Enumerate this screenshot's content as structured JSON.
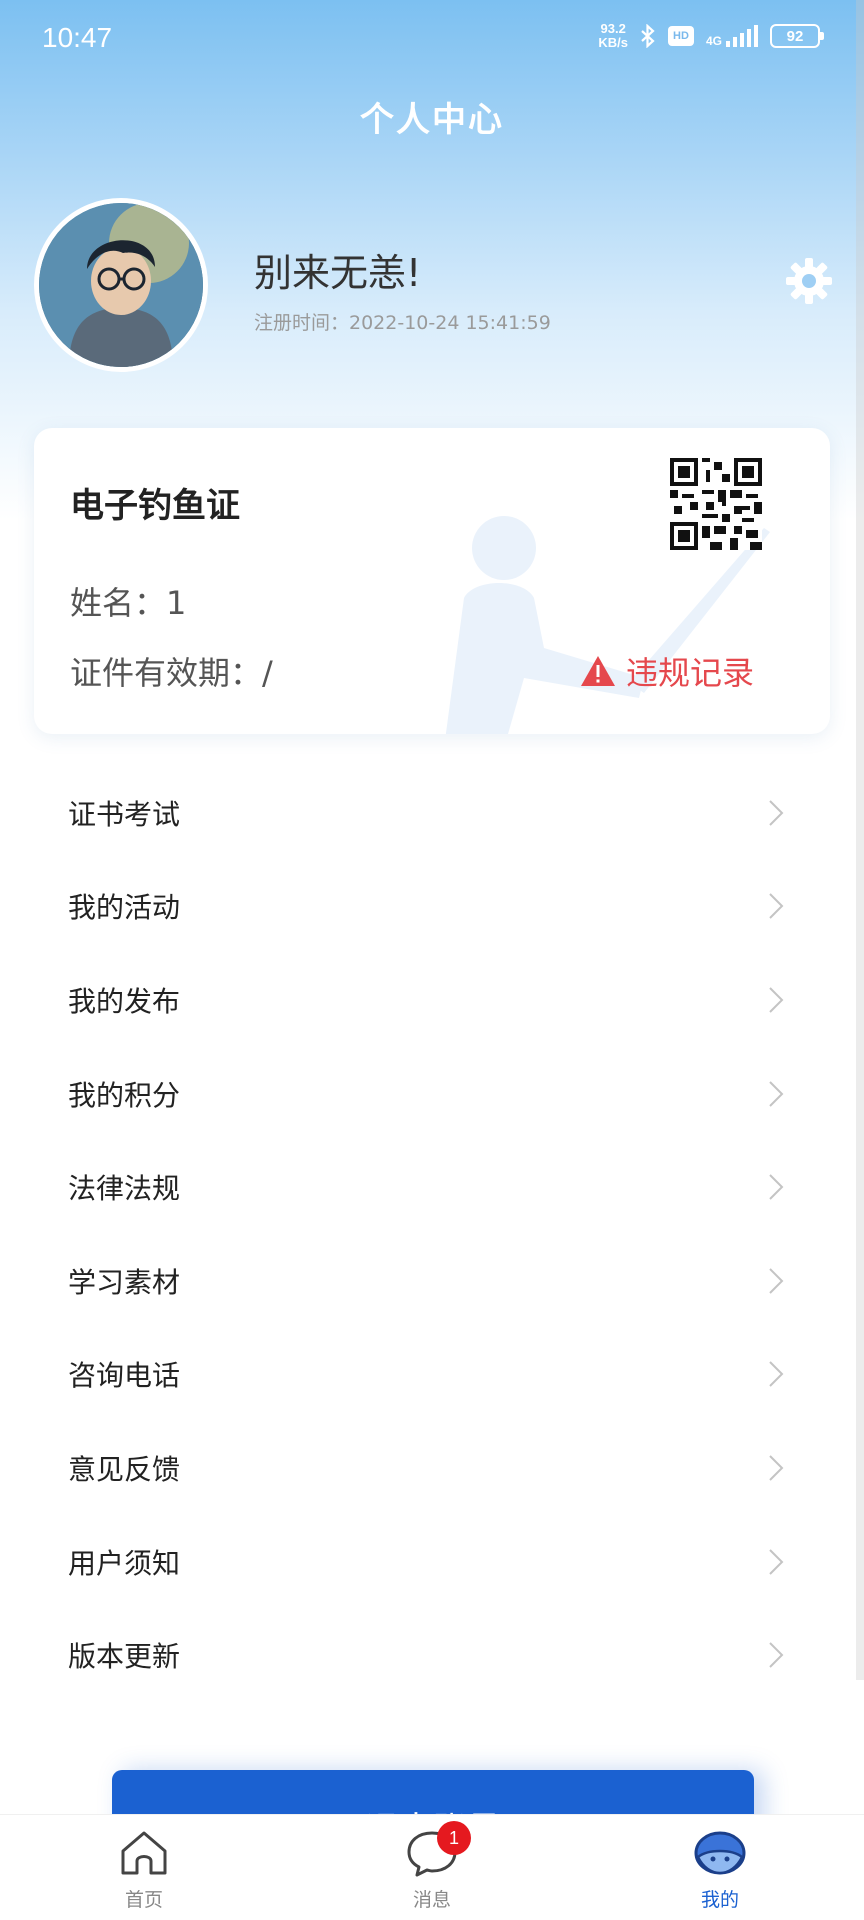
{
  "status_bar": {
    "time": "10:47",
    "net_speed_value": "93.2",
    "net_speed_unit": "KB/s",
    "hd_label": "HD",
    "network_label": "4G",
    "battery": "92"
  },
  "header": {
    "title": "个人中心"
  },
  "profile": {
    "username": "别来无恙!",
    "register_time": "注册时间：2022-10-24 15:41:59"
  },
  "license_card": {
    "title": "电子钓鱼证",
    "name_line": "姓名：1",
    "validity_line": "证件有效期：/",
    "violation_label": "违规记录"
  },
  "menu": {
    "items": [
      {
        "label": "证书考试"
      },
      {
        "label": "我的活动"
      },
      {
        "label": "我的发布"
      },
      {
        "label": "我的积分"
      },
      {
        "label": "法律法规"
      },
      {
        "label": "学习素材"
      },
      {
        "label": "咨询电话"
      },
      {
        "label": "意见反馈"
      },
      {
        "label": "用户须知"
      },
      {
        "label": "版本更新"
      }
    ]
  },
  "logout_label": "退出账号",
  "tabbar": {
    "tabs": [
      {
        "label": "首页",
        "icon": "home-icon"
      },
      {
        "label": "消息",
        "icon": "chat-bubble-icon",
        "badge": "1"
      },
      {
        "label": "我的",
        "icon": "profile-fish-icon",
        "active": true
      }
    ]
  },
  "colors": {
    "primary": "#1b61d1",
    "warning": "#e5484d",
    "header_gradient_top": "#7cc0f1",
    "badge": "#e5191f"
  }
}
